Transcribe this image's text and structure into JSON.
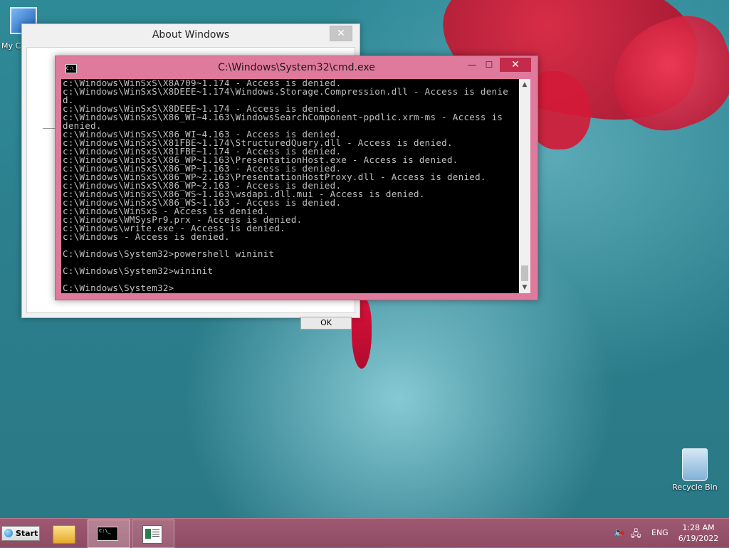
{
  "desktop": {
    "icons": [
      {
        "label": "My C"
      },
      {
        "label": "Recycle Bin"
      }
    ]
  },
  "about_window": {
    "title": "About Windows",
    "close_glyph": "✕",
    "ok_label": "OK"
  },
  "cmd_window": {
    "title": "C:\\Windows\\System32\\cmd.exe",
    "icon_text": "C:\\_",
    "minimize_glyph": "—",
    "maximize_glyph": "☐",
    "close_glyph": "✕",
    "lines": [
      "c:\\Windows\\WinSxS\\X8A709~1.174 - Access is denied.",
      "c:\\Windows\\WinSxS\\X8DEEE~1.174\\Windows.Storage.Compression.dll - Access is denie",
      "d.",
      "c:\\Windows\\WinSxS\\X8DEEE~1.174 - Access is denied.",
      "c:\\Windows\\WinSxS\\X86_WI~4.163\\WindowsSearchComponent-ppdlic.xrm-ms - Access is",
      "denied.",
      "c:\\Windows\\WinSxS\\X86_WI~4.163 - Access is denied.",
      "c:\\Windows\\WinSxS\\X81FBE~1.174\\StructuredQuery.dll - Access is denied.",
      "c:\\Windows\\WinSxS\\X81FBE~1.174 - Access is denied.",
      "c:\\Windows\\WinSxS\\X86_WP~1.163\\PresentationHost.exe - Access is denied.",
      "c:\\Windows\\WinSxS\\X86_WP~1.163 - Access is denied.",
      "c:\\Windows\\WinSxS\\X86_WP~2.163\\PresentationHostProxy.dll - Access is denied.",
      "c:\\Windows\\WinSxS\\X86_WP~2.163 - Access is denied.",
      "c:\\Windows\\WinSxS\\X86_WS~1.163\\wsdapi.dll.mui - Access is denied.",
      "c:\\Windows\\WinSxS\\X86_WS~1.163 - Access is denied.",
      "c:\\Windows\\WinSxS - Access is denied.",
      "c:\\Windows\\WMSysPr9.prx - Access is denied.",
      "c:\\Windows\\write.exe - Access is denied.",
      "c:\\Windows - Access is denied.",
      "",
      "C:\\Windows\\System32>powershell wininit",
      "",
      "C:\\Windows\\System32>wininit",
      "",
      "C:\\Windows\\System32>"
    ],
    "scroll_up_glyph": "▲",
    "scroll_down_glyph": "▼"
  },
  "taskbar": {
    "start_label": "Start",
    "cmd_icon_text": "C:\\_",
    "language": "ENG",
    "time": "1:28 AM",
    "date": "6/19/2022"
  }
}
